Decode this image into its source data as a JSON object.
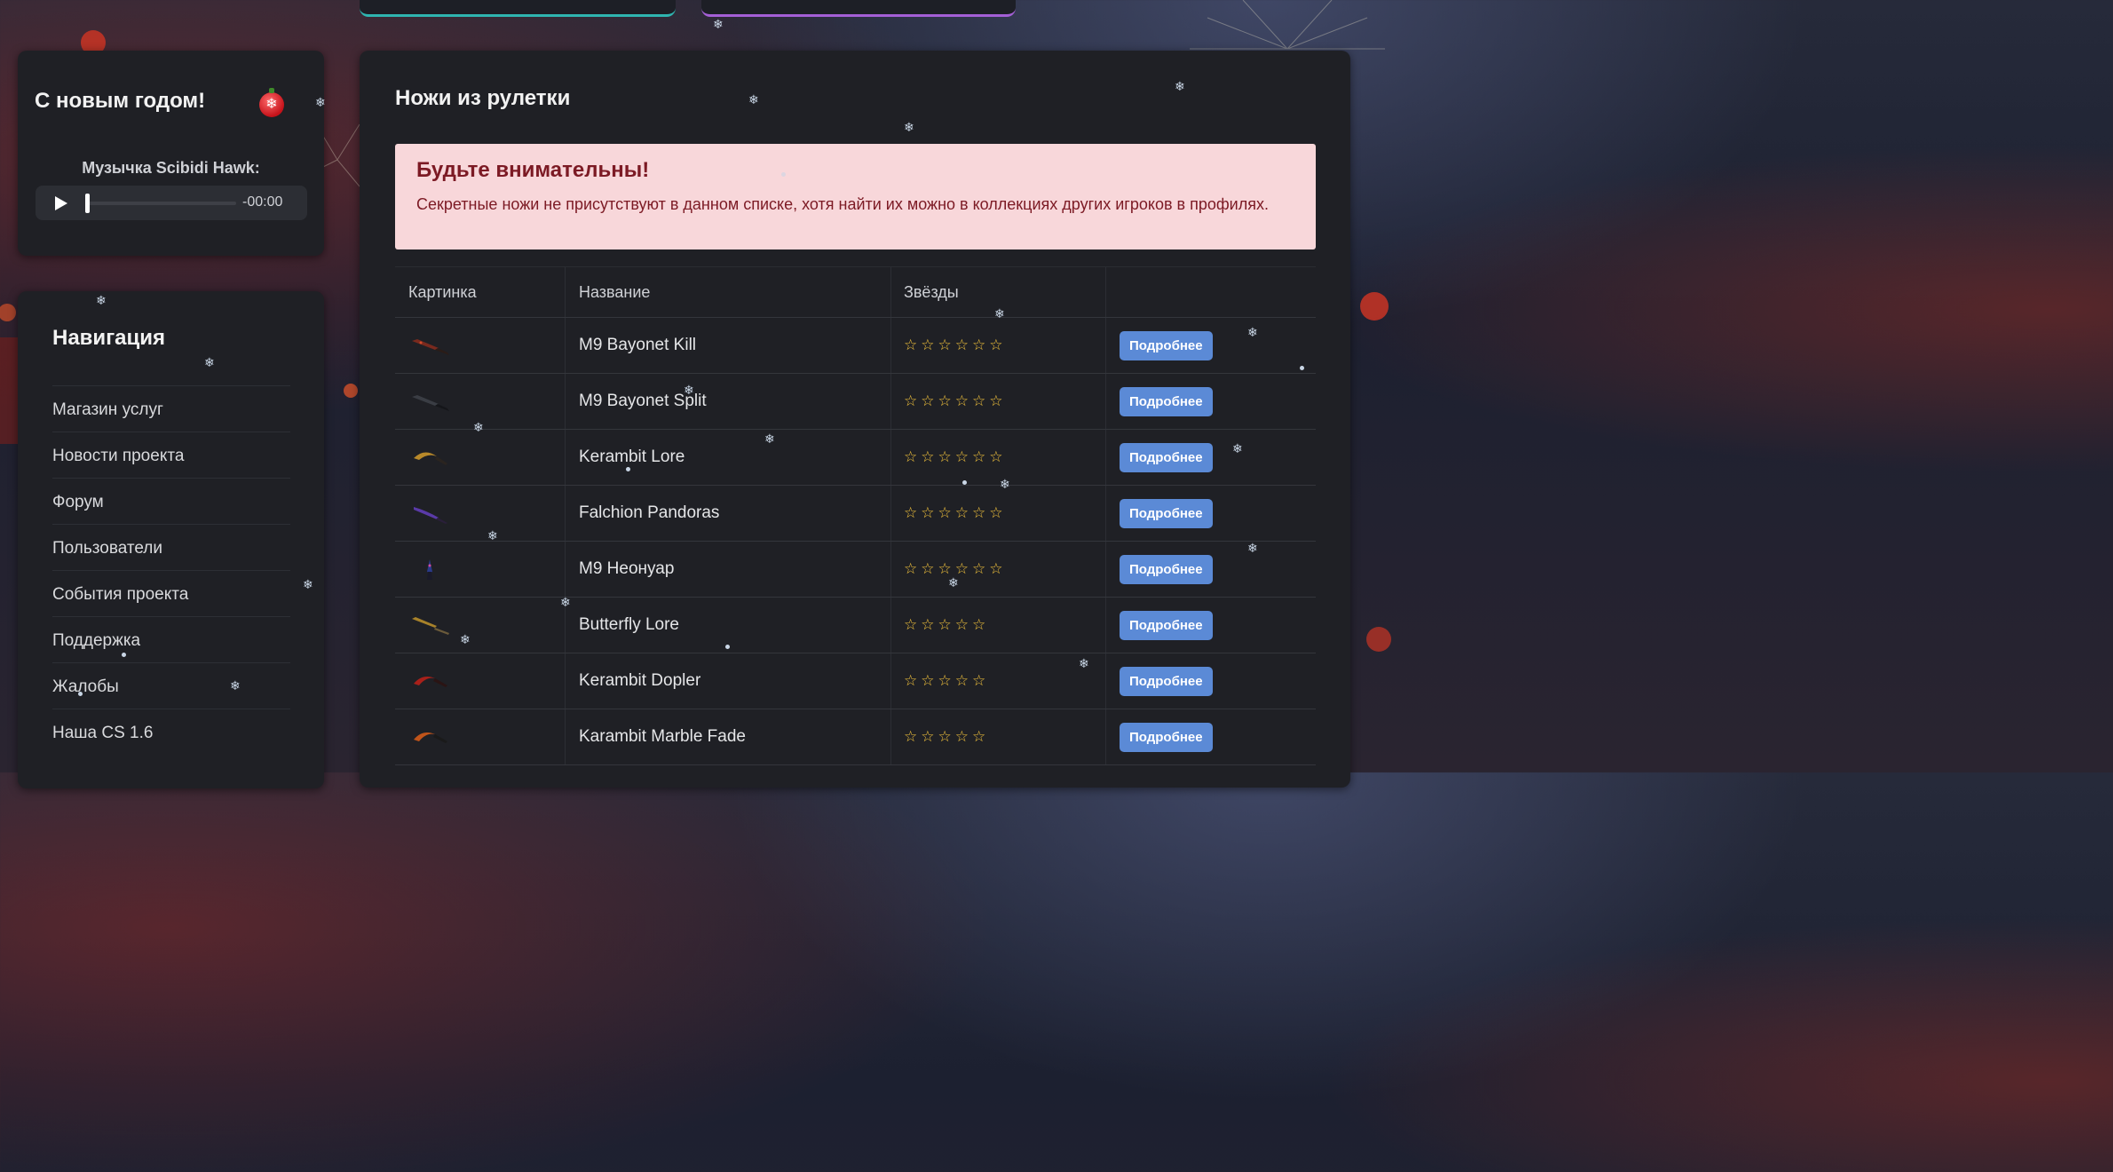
{
  "music": {
    "title": "С новым годом!",
    "label": "Музычка Scibidi Hawk:",
    "time": "-00:00",
    "progress": 0
  },
  "nav": {
    "title": "Навигация",
    "items": [
      {
        "label": "Магазин услуг"
      },
      {
        "label": "Новости проекта"
      },
      {
        "label": "Форум"
      },
      {
        "label": "Пользователи"
      },
      {
        "label": "События проекта"
      },
      {
        "label": "Поддержка"
      },
      {
        "label": "Жалобы"
      },
      {
        "label": "Наша CS 1.6"
      }
    ]
  },
  "main": {
    "title": "Ножи из рулетки",
    "alert": {
      "title": "Будьте внимательны!",
      "text": "Секретные ножи не присутствуют в данном списке, хотя найти их можно в коллекциях других игроков в профилях."
    },
    "table": {
      "headers": {
        "image": "Картинка",
        "name": "Название",
        "stars": "Звёзды",
        "action": ""
      },
      "rows": [
        {
          "name": "M9 Bayonet Kill",
          "stars": "☆☆☆☆☆☆",
          "star_count": 6,
          "button": "Подробнее",
          "icon": "knife-m9-red-icon"
        },
        {
          "name": "M9 Bayonet Split",
          "stars": "☆☆☆☆☆☆",
          "star_count": 6,
          "button": "Подробнее",
          "icon": "knife-m9-dark-icon"
        },
        {
          "name": "Kerambit Lore",
          "stars": "☆☆☆☆☆☆",
          "star_count": 6,
          "button": "Подробнее",
          "icon": "knife-karambit-gold-icon"
        },
        {
          "name": "Falchion Pandoras",
          "stars": "☆☆☆☆☆☆",
          "star_count": 6,
          "button": "Подробнее",
          "icon": "knife-falchion-purple-icon"
        },
        {
          "name": "M9 Неонуар",
          "stars": "☆☆☆☆☆☆",
          "star_count": 6,
          "button": "Подробнее",
          "icon": "knife-m9-neon-icon"
        },
        {
          "name": "Butterfly Lore",
          "stars": "☆☆☆☆☆",
          "star_count": 5,
          "button": "Подробнее",
          "icon": "knife-butterfly-gold-icon"
        },
        {
          "name": "Kerambit Dopler",
          "stars": "☆☆☆☆☆",
          "star_count": 5,
          "button": "Подробнее",
          "icon": "knife-karambit-red-icon"
        },
        {
          "name": "Karambit Marble Fade",
          "stars": "☆☆☆☆☆",
          "star_count": 5,
          "button": "Подробнее",
          "icon": "knife-karambit-fade-icon"
        }
      ]
    }
  },
  "colors": {
    "accent_button": "#5b8ad6",
    "alert_bg": "#f8d7da",
    "alert_text": "#7c1a24",
    "star": "#f0c13c",
    "tab_teal": "#2fb5b0",
    "tab_purple": "#a45fd6"
  }
}
